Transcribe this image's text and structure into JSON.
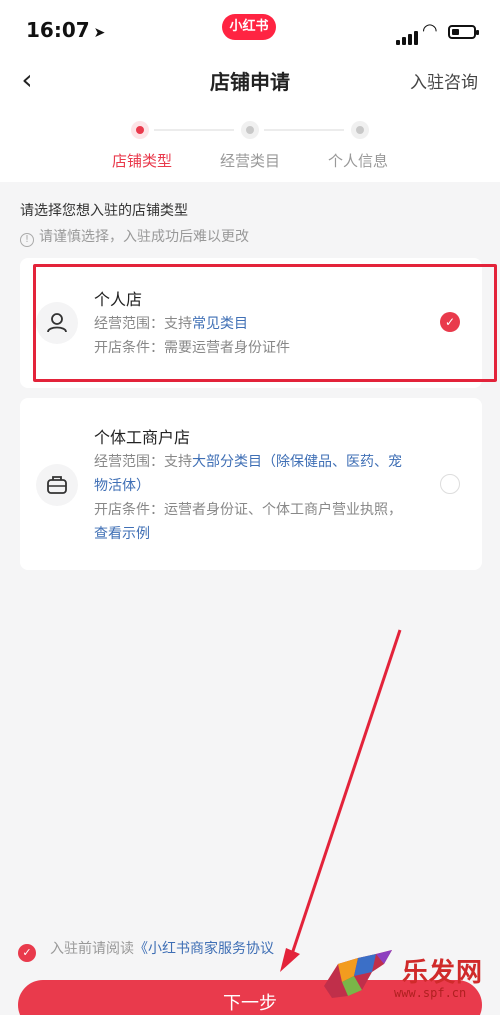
{
  "status_bar": {
    "time": "16:07",
    "app_badge": "小红书"
  },
  "nav": {
    "title": "店铺申请",
    "consult_label": "入驻咨询"
  },
  "steps": [
    {
      "label": "店铺类型",
      "active": true
    },
    {
      "label": "经营类目",
      "active": false
    },
    {
      "label": "个人信息",
      "active": false
    }
  ],
  "prompt": "请选择您想入驻的店铺类型",
  "warning": "请谨慎选择，入驻成功后难以更改",
  "shops": [
    {
      "title": "个人店",
      "scope_prefix": "经营范围：支持",
      "scope_link": "常见类目",
      "condition": "开店条件：需要运营者身份证件",
      "selected": true,
      "icon": "person-icon"
    },
    {
      "title": "个体工商户店",
      "scope_prefix": "经营范围：支持",
      "scope_link": "大部分类目（除保健品、医药、宠物活体）",
      "condition": "开店条件：运营者身份证、个体工商户营业执照，",
      "condition_link": "查看示例",
      "selected": false,
      "icon": "briefcase-icon"
    }
  ],
  "agreement": {
    "prefix": "入驻前请阅读",
    "link": "《小红书商家服务协议"
  },
  "next_button": "下一步",
  "watermark": {
    "text": "乐发网",
    "url": "www.spf.cn"
  },
  "colors": {
    "accent": "#e93a4c",
    "link": "#3f6fb5",
    "highlight_box": "#e3233a"
  }
}
